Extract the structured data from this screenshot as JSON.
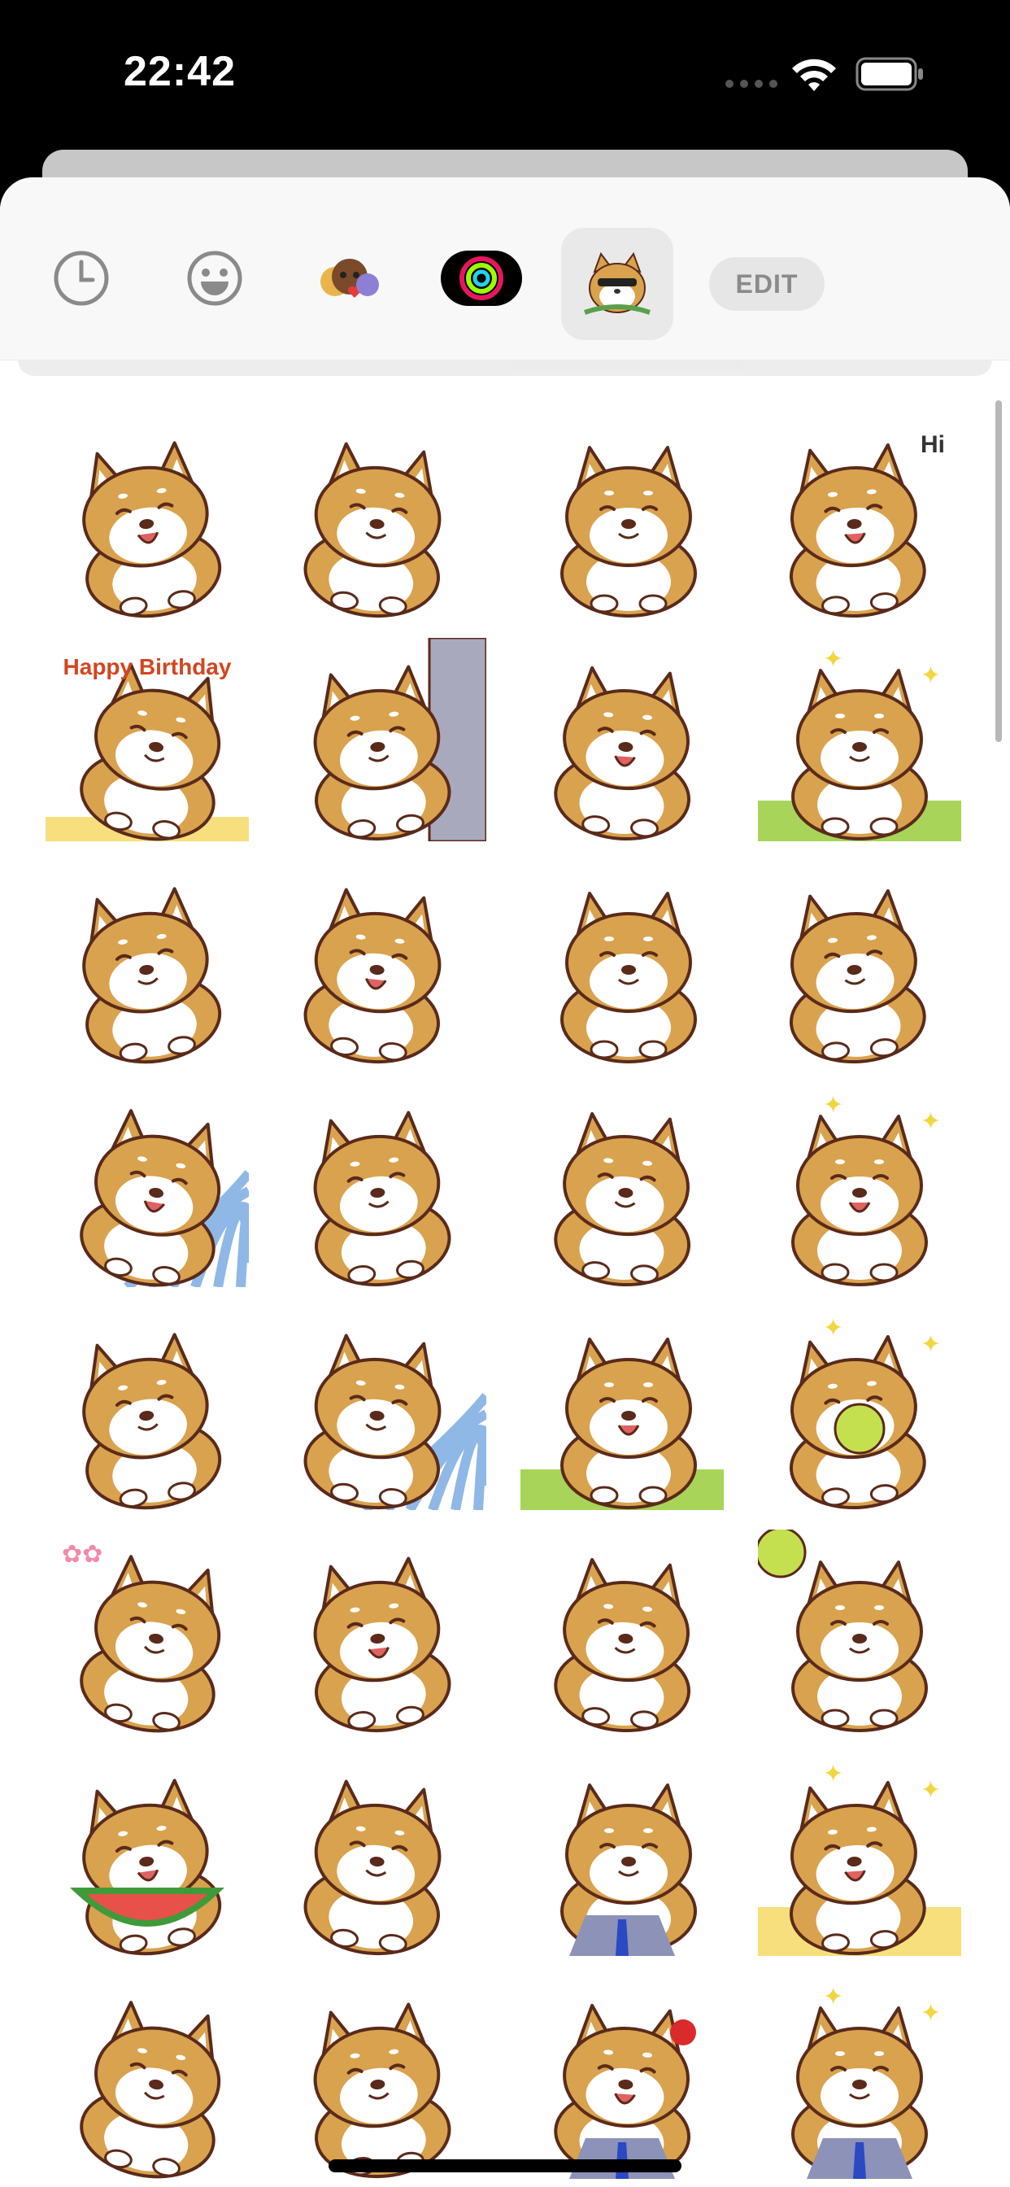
{
  "status_bar": {
    "time": "22:42"
  },
  "tabs": [
    {
      "name": "recents",
      "icon": "clock-icon",
      "selected": false
    },
    {
      "name": "emoji",
      "icon": "smiley-icon",
      "selected": false
    },
    {
      "name": "memoji",
      "icon": "memoji-icon",
      "selected": false
    },
    {
      "name": "activity",
      "icon": "activity-rings-icon",
      "selected": false
    },
    {
      "name": "shiba-pack",
      "icon": "shiba-sticker-icon",
      "selected": true
    }
  ],
  "edit_label": "EDIT",
  "stickers": [
    {
      "pose": "sitting-in-hole",
      "bg": "none"
    },
    {
      "pose": "peeking-corner",
      "bg": "none"
    },
    {
      "pose": "laughing-arms-up",
      "bg": "none"
    },
    {
      "pose": "waving-hi",
      "bg": "none",
      "text": "Hi"
    },
    {
      "pose": "birthday-cake",
      "bg": "cake",
      "text": "Happy Birthday"
    },
    {
      "pose": "behind-door",
      "bg": "door"
    },
    {
      "pose": "shocked-sweat",
      "bg": "none"
    },
    {
      "pose": "flowers-happy",
      "bg": "green"
    },
    {
      "pose": "sitting-sad",
      "bg": "none"
    },
    {
      "pose": "hand-on-face",
      "bg": "none"
    },
    {
      "pose": "leash-pulled",
      "bg": "none"
    },
    {
      "pose": "smug",
      "bg": "none"
    },
    {
      "pose": "sleeping-blanket",
      "bg": "stripes"
    },
    {
      "pose": "grumpy-teeth",
      "bg": "none"
    },
    {
      "pose": "angry-fur",
      "bg": "none"
    },
    {
      "pose": "proud-sparkles",
      "bg": "none"
    },
    {
      "pose": "butt-view",
      "bg": "none"
    },
    {
      "pose": "laughing-lying",
      "bg": "stripes"
    },
    {
      "pose": "hiding-worried",
      "bg": "green"
    },
    {
      "pose": "tennis-ball",
      "bg": "none"
    },
    {
      "pose": "blushing-flowers",
      "bg": "none"
    },
    {
      "pose": "buck-teeth",
      "bg": "none"
    },
    {
      "pose": "yawning",
      "bg": "none"
    },
    {
      "pose": "ball-catch",
      "bg": "none"
    },
    {
      "pose": "watermelon",
      "bg": "none"
    },
    {
      "pose": "squished-cheeks",
      "bg": "none"
    },
    {
      "pose": "office-glasses",
      "bg": "none"
    },
    {
      "pose": "brown-puppy",
      "bg": "yellow"
    },
    {
      "pose": "paws-up",
      "bg": "none"
    },
    {
      "pose": "cheerleader",
      "bg": "none"
    },
    {
      "pose": "rose-suit",
      "bg": "none"
    },
    {
      "pose": "sparkle-eyes",
      "bg": "none"
    }
  ],
  "colors": {
    "fur": "#d9a24e",
    "fur_light": "#e8b865",
    "outline": "#5a2a1a",
    "cream": "#ffffff",
    "tongue": "#e06262",
    "green_bg": "#a8d45a",
    "stripe_blue": "#8fb8e6",
    "cake_yellow": "#f7df7d"
  }
}
